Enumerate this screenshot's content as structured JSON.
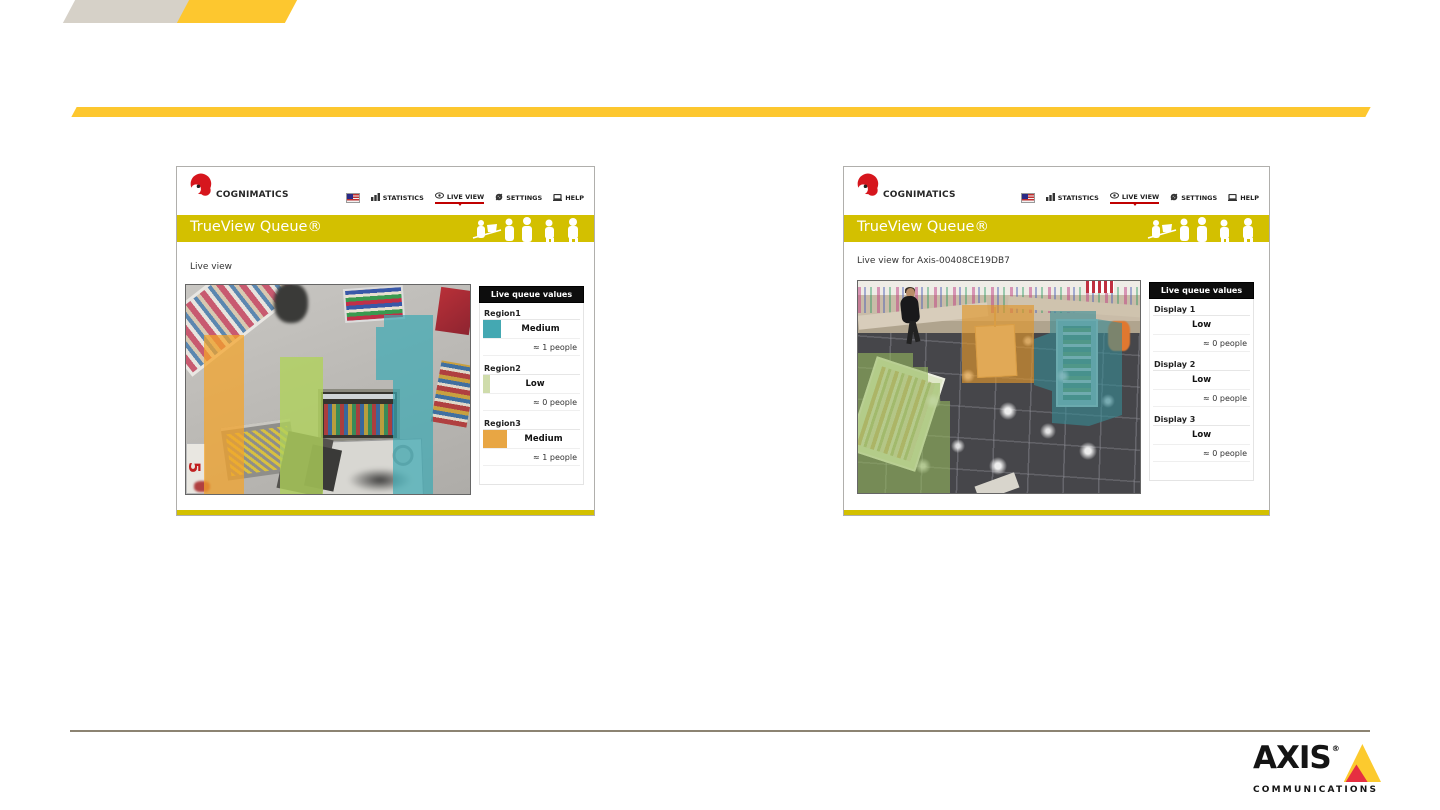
{
  "decor": {
    "accent_yellow": "#fdc72f",
    "accent_beige": "#d6d1c8",
    "app_banner_yellow": "#d3c000",
    "rule_line_color": "#8c8372"
  },
  "apps": {
    "left": {
      "brand": "COGNIMATICS",
      "nav": {
        "statistics": "STATISTICS",
        "live_view": "LIVE VIEW",
        "settings": "SETTINGS",
        "help": "HELP"
      },
      "banner": "TrueView Queue®",
      "title": "Live view",
      "camera_sign_text": "5",
      "camera_regions": {
        "orange": "rgba(244,164,40,0.72)",
        "green": "rgba(175,210,90,0.78)",
        "teal": "rgba(60,170,180,0.70)"
      },
      "panel": {
        "header": "Live queue values",
        "rows": [
          {
            "label": "Region1",
            "level": "Medium",
            "people": "≈ 1 people",
            "swatch": "#44a8b2"
          },
          {
            "label": "Region2",
            "level": "Low",
            "people": "≈ 0 people",
            "swatch": "#cfdcab"
          },
          {
            "label": "Region3",
            "level": "Medium",
            "people": "≈ 1 people",
            "swatch": "#e8a644"
          }
        ]
      }
    },
    "right": {
      "brand": "COGNIMATICS",
      "nav": {
        "statistics": "STATISTICS",
        "live_view": "LIVE VIEW",
        "settings": "SETTINGS",
        "help": "HELP"
      },
      "banner": "TrueView Queue®",
      "title": "Live view for Axis-00408CE19DB7",
      "camera_regions": {
        "green": "rgba(150,185,95,0.60)",
        "orange": "rgba(225,150,45,0.65)",
        "teal": "rgba(55,140,150,0.60)"
      },
      "panel": {
        "header": "Live queue values",
        "rows": [
          {
            "label": "Display 1",
            "level": "Low",
            "people": "≈ 0 people"
          },
          {
            "label": "Display 2",
            "level": "Low",
            "people": "≈ 0 people"
          },
          {
            "label": "Display 3",
            "level": "Low",
            "people": "≈ 0 people"
          }
        ]
      }
    }
  },
  "footer_logo": {
    "name": "AXIS",
    "reg": "®",
    "sub": "COMMUNICATIONS",
    "triangle_yellow": "#fcca2e",
    "triangle_red": "#e62f41"
  }
}
